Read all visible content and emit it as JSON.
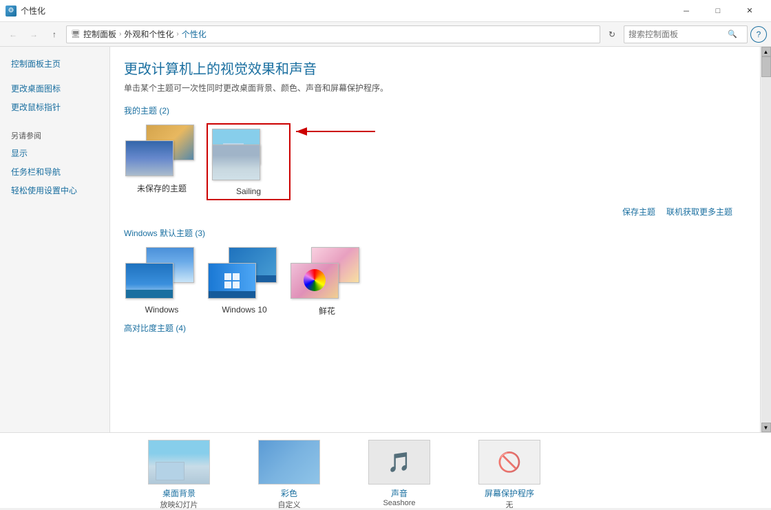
{
  "window": {
    "title": "个性化",
    "icon": "settings-icon"
  },
  "titlebar": {
    "title": "个性化",
    "minimize_label": "－",
    "maximize_label": "□",
    "close_label": "✕"
  },
  "addressbar": {
    "back_btn": "←",
    "forward_btn": "→",
    "up_btn": "↑",
    "refresh_btn": "↻",
    "path_parts": [
      "控制面板",
      "外观和个性化",
      "个性化"
    ],
    "search_placeholder": "搜索控制面板",
    "help_btn": "?"
  },
  "sidebar": {
    "main_link": "控制面板主页",
    "items": [
      {
        "label": "更改桌面图标"
      },
      {
        "label": "更改鼠标指针"
      }
    ],
    "also_see_title": "另请参阅",
    "also_see_items": [
      {
        "label": "显示"
      },
      {
        "label": "任务栏和导航"
      },
      {
        "label": "轻松使用设置中心"
      }
    ]
  },
  "content": {
    "title": "更改计算机上的视觉效果和声音",
    "description": "单击某个主题可一次性同时更改桌面背景、颜色、声音和屏幕保护程序。",
    "my_themes": {
      "title": "我的主题 (2)",
      "themes": [
        {
          "name": "未保存的主题",
          "selected": false
        },
        {
          "name": "Sailing",
          "selected": true
        }
      ]
    },
    "windows_themes": {
      "title": "Windows 默认主题 (3)",
      "themes": [
        {
          "name": "Windows",
          "selected": false
        },
        {
          "name": "Windows 10",
          "selected": false
        },
        {
          "name": "鲜花",
          "selected": false
        }
      ]
    },
    "high_contrast": {
      "title": "高对比度主题 (4)"
    },
    "actions": {
      "save_label": "保存主题",
      "get_more_label": "联机获取更多主题"
    }
  },
  "bottom_bar": {
    "items": [
      {
        "label": "桌面背景",
        "sublabel": "放映幻灯片",
        "icon": "desktop-icon"
      },
      {
        "label": "彩色",
        "sublabel": "自定义",
        "icon": "color-icon"
      },
      {
        "label": "声音",
        "sublabel": "Seashore",
        "icon": "sound-icon"
      },
      {
        "label": "屏幕保护程序",
        "sublabel": "无",
        "icon": "screen-icon"
      }
    ]
  }
}
